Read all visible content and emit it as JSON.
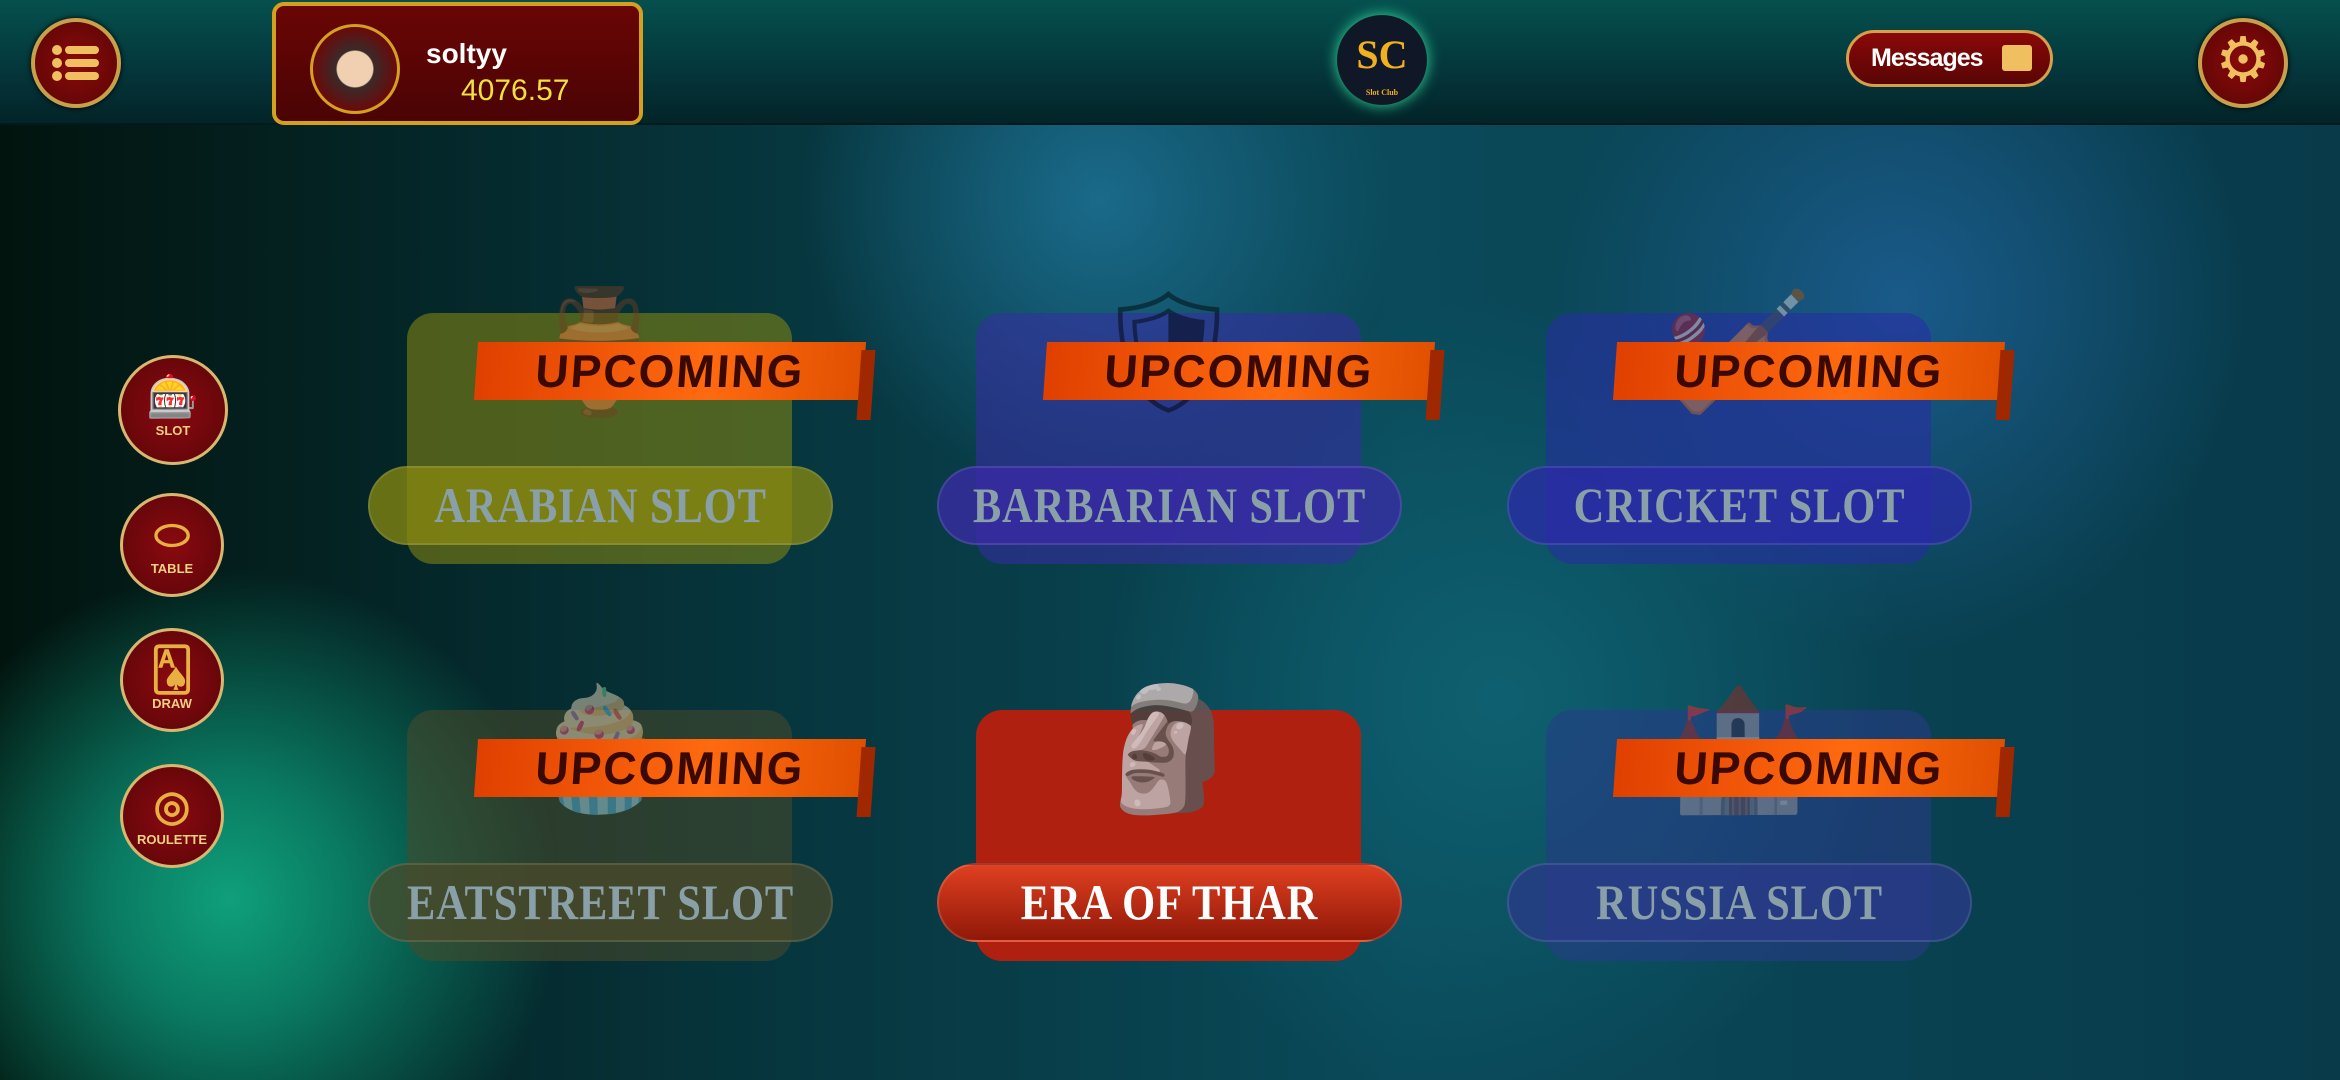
{
  "header": {
    "username": "soltyy",
    "balance": "4076.57",
    "logo_text": "SC",
    "logo_sub": "Slot Club",
    "messages_label": "Messages"
  },
  "sidebar": [
    {
      "label": "SLOT",
      "icon": "slot-machine-icon"
    },
    {
      "label": "TABLE",
      "icon": "table-icon"
    },
    {
      "label": "DRAW",
      "icon": "cards-icon"
    },
    {
      "label": "ROULETTE",
      "icon": "roulette-icon"
    }
  ],
  "games": [
    {
      "title": "ARABIAN SLOT",
      "badge": "UPCOMING",
      "color": "#8a8a10"
    },
    {
      "title": "BARBARIAN SLOT",
      "badge": "UPCOMING",
      "color": "#3a2aa8"
    },
    {
      "title": "CRICKET SLOT",
      "badge": "UPCOMING",
      "color": "#2a2aa8"
    },
    {
      "title": "EATSTREET SLOT",
      "badge": "UPCOMING",
      "color": "#4a4a2a"
    },
    {
      "title": "ERA OF THAR",
      "badge": "",
      "color": "#b02010"
    },
    {
      "title": "RUSSIA SLOT",
      "badge": "UPCOMING",
      "color": "#2a3a8a"
    }
  ]
}
